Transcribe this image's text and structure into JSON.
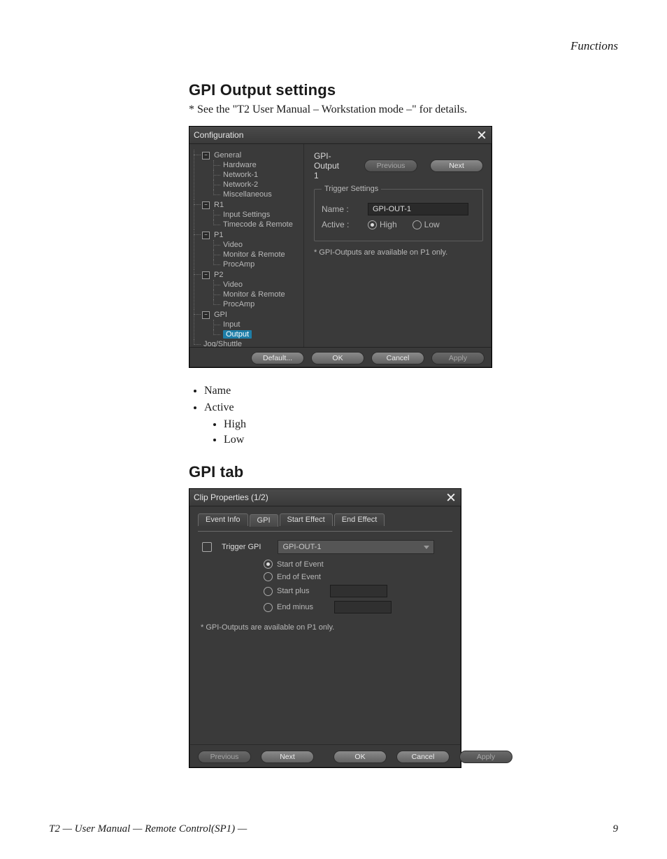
{
  "header": {
    "running": "Functions"
  },
  "sec1": {
    "title": "GPI Output settings",
    "note": "* See the \"T2 User Manual – Workstation mode –\" for details."
  },
  "cfg": {
    "title": "Configuration",
    "tree": {
      "general": "General",
      "general_children": [
        "Hardware",
        "Network-1",
        "Network-2",
        "Miscellaneous"
      ],
      "r1": "R1",
      "r1_children": [
        "Input Settings",
        "Timecode & Remote"
      ],
      "p1": "P1",
      "p_children": [
        "Video",
        "Monitor & Remote",
        "ProcAmp"
      ],
      "p2": "P2",
      "gpi": "GPI",
      "gpi_children": [
        "Input",
        "Output"
      ],
      "jog": "Jog/Shuttle"
    },
    "pane": {
      "heading": "GPI-Output 1",
      "prev": "Previous",
      "next": "Next",
      "legend": "Trigger Settings",
      "name_lbl": "Name :",
      "name_val": "GPI-OUT-1",
      "active_lbl": "Active :",
      "high": "High",
      "low": "Low",
      "hint": "* GPI-Outputs are available on P1 only."
    },
    "footer": {
      "default": "Default...",
      "ok": "OK",
      "cancel": "Cancel",
      "apply": "Apply"
    }
  },
  "bullets": {
    "name": "Name",
    "active": "Active",
    "high": "High",
    "low": "Low"
  },
  "sec2": {
    "title": "GPI tab"
  },
  "clip": {
    "title": "Clip Properties (1/2)",
    "tabs": [
      "Event Info",
      "GPI",
      "Start Effect",
      "End Effect"
    ],
    "trigger_lbl": "Trigger GPI",
    "combo": "GPI-OUT-1",
    "opts": [
      "Start of Event",
      "End of Event",
      "Start plus",
      "End minus"
    ],
    "hint": "* GPI-Outputs are available on P1 only.",
    "footer": {
      "prev": "Previous",
      "next": "Next",
      "ok": "OK",
      "cancel": "Cancel",
      "apply": "Apply"
    }
  },
  "footer": {
    "left": "T2  —  User Manual  —  Remote Control(SP1)  —",
    "page": "9"
  }
}
